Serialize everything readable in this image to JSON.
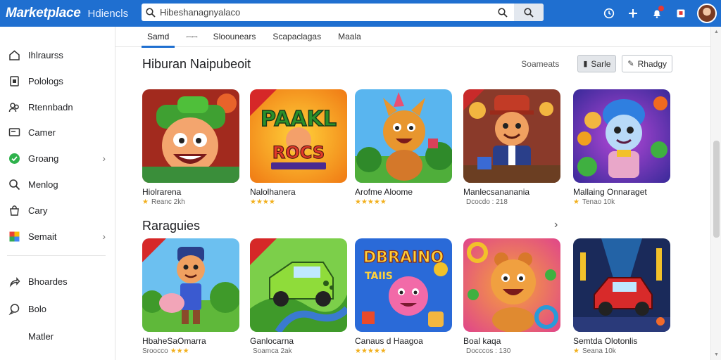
{
  "header": {
    "brand": "Marketplace",
    "brand_sub": "Hdiencls",
    "search_value": "Hibeshanagnyalaco"
  },
  "tabs": [
    {
      "label": "Samd"
    },
    {
      "label": "Sloounears"
    },
    {
      "label": "Scapaclagas"
    },
    {
      "label": "Maala"
    }
  ],
  "tabs_dots": "ꟷꟷ",
  "sidebar": {
    "items": [
      {
        "label": "Ihlraurss",
        "icon": "home-icon"
      },
      {
        "label": "Polologs",
        "icon": "document-icon"
      },
      {
        "label": "Rtennbadn",
        "icon": "people-icon"
      },
      {
        "label": "Camer",
        "icon": "monitor-icon"
      },
      {
        "label": "Groang",
        "icon": "check-circle-icon"
      },
      {
        "label": "Menlog",
        "icon": "search-icon"
      },
      {
        "label": "Cary",
        "icon": "bag-icon"
      },
      {
        "label": "Semait",
        "icon": "apps-icon"
      },
      {
        "label": "Bhoardes",
        "icon": "share-icon"
      },
      {
        "label": "Bolo",
        "icon": "chat-icon"
      },
      {
        "label": "Matler",
        "icon": ""
      }
    ]
  },
  "section1": {
    "title": "Hiburan Naipubeoit",
    "tools_text": "Soameats",
    "btn_filled": "Sarle",
    "btn_outline": "Rhadgy",
    "cards": [
      {
        "title": "Hiolrarena",
        "rating_text": "Reanc 2kh",
        "stars": "★"
      },
      {
        "title": "Nalolhanera",
        "rating_text": "",
        "stars": "★★★★"
      },
      {
        "title": "Arofme Aloome",
        "rating_text": "",
        "stars": "★★★★★"
      },
      {
        "title": "Manlecsananania",
        "rating_text": "Dcocdo : 218",
        "stars": ""
      },
      {
        "title": "Mallaing Onnaraget",
        "rating_text": "Tenao 10k",
        "stars": "★"
      }
    ]
  },
  "section2": {
    "title": "Raraguies",
    "cards": [
      {
        "title": "HbaheSaOmarra",
        "rating_text": "Sroocco",
        "stars": "★★★"
      },
      {
        "title": "Ganlocarna",
        "rating_text": "Soamca 2ak",
        "stars": ""
      },
      {
        "title": "Canaus d Haagoa",
        "rating_text": "",
        "stars": "★★★★★"
      },
      {
        "title": "Boal kaqa",
        "rating_text": "Docccos : 130",
        "stars": ""
      },
      {
        "title": "Semtda Olotonlis",
        "rating_text": "Seana 10k",
        "stars": "★"
      }
    ]
  },
  "thumb_art": {
    "s1c2_text": "PAAKL",
    "s1c2_text2": "ROCS",
    "s2c3_text": "DBRAINO",
    "s2c3_text2": "TAIIS"
  },
  "colors": {
    "topbar": "#1f6fd0",
    "accent": "#1f6fd0",
    "star": "#f2b01e"
  }
}
